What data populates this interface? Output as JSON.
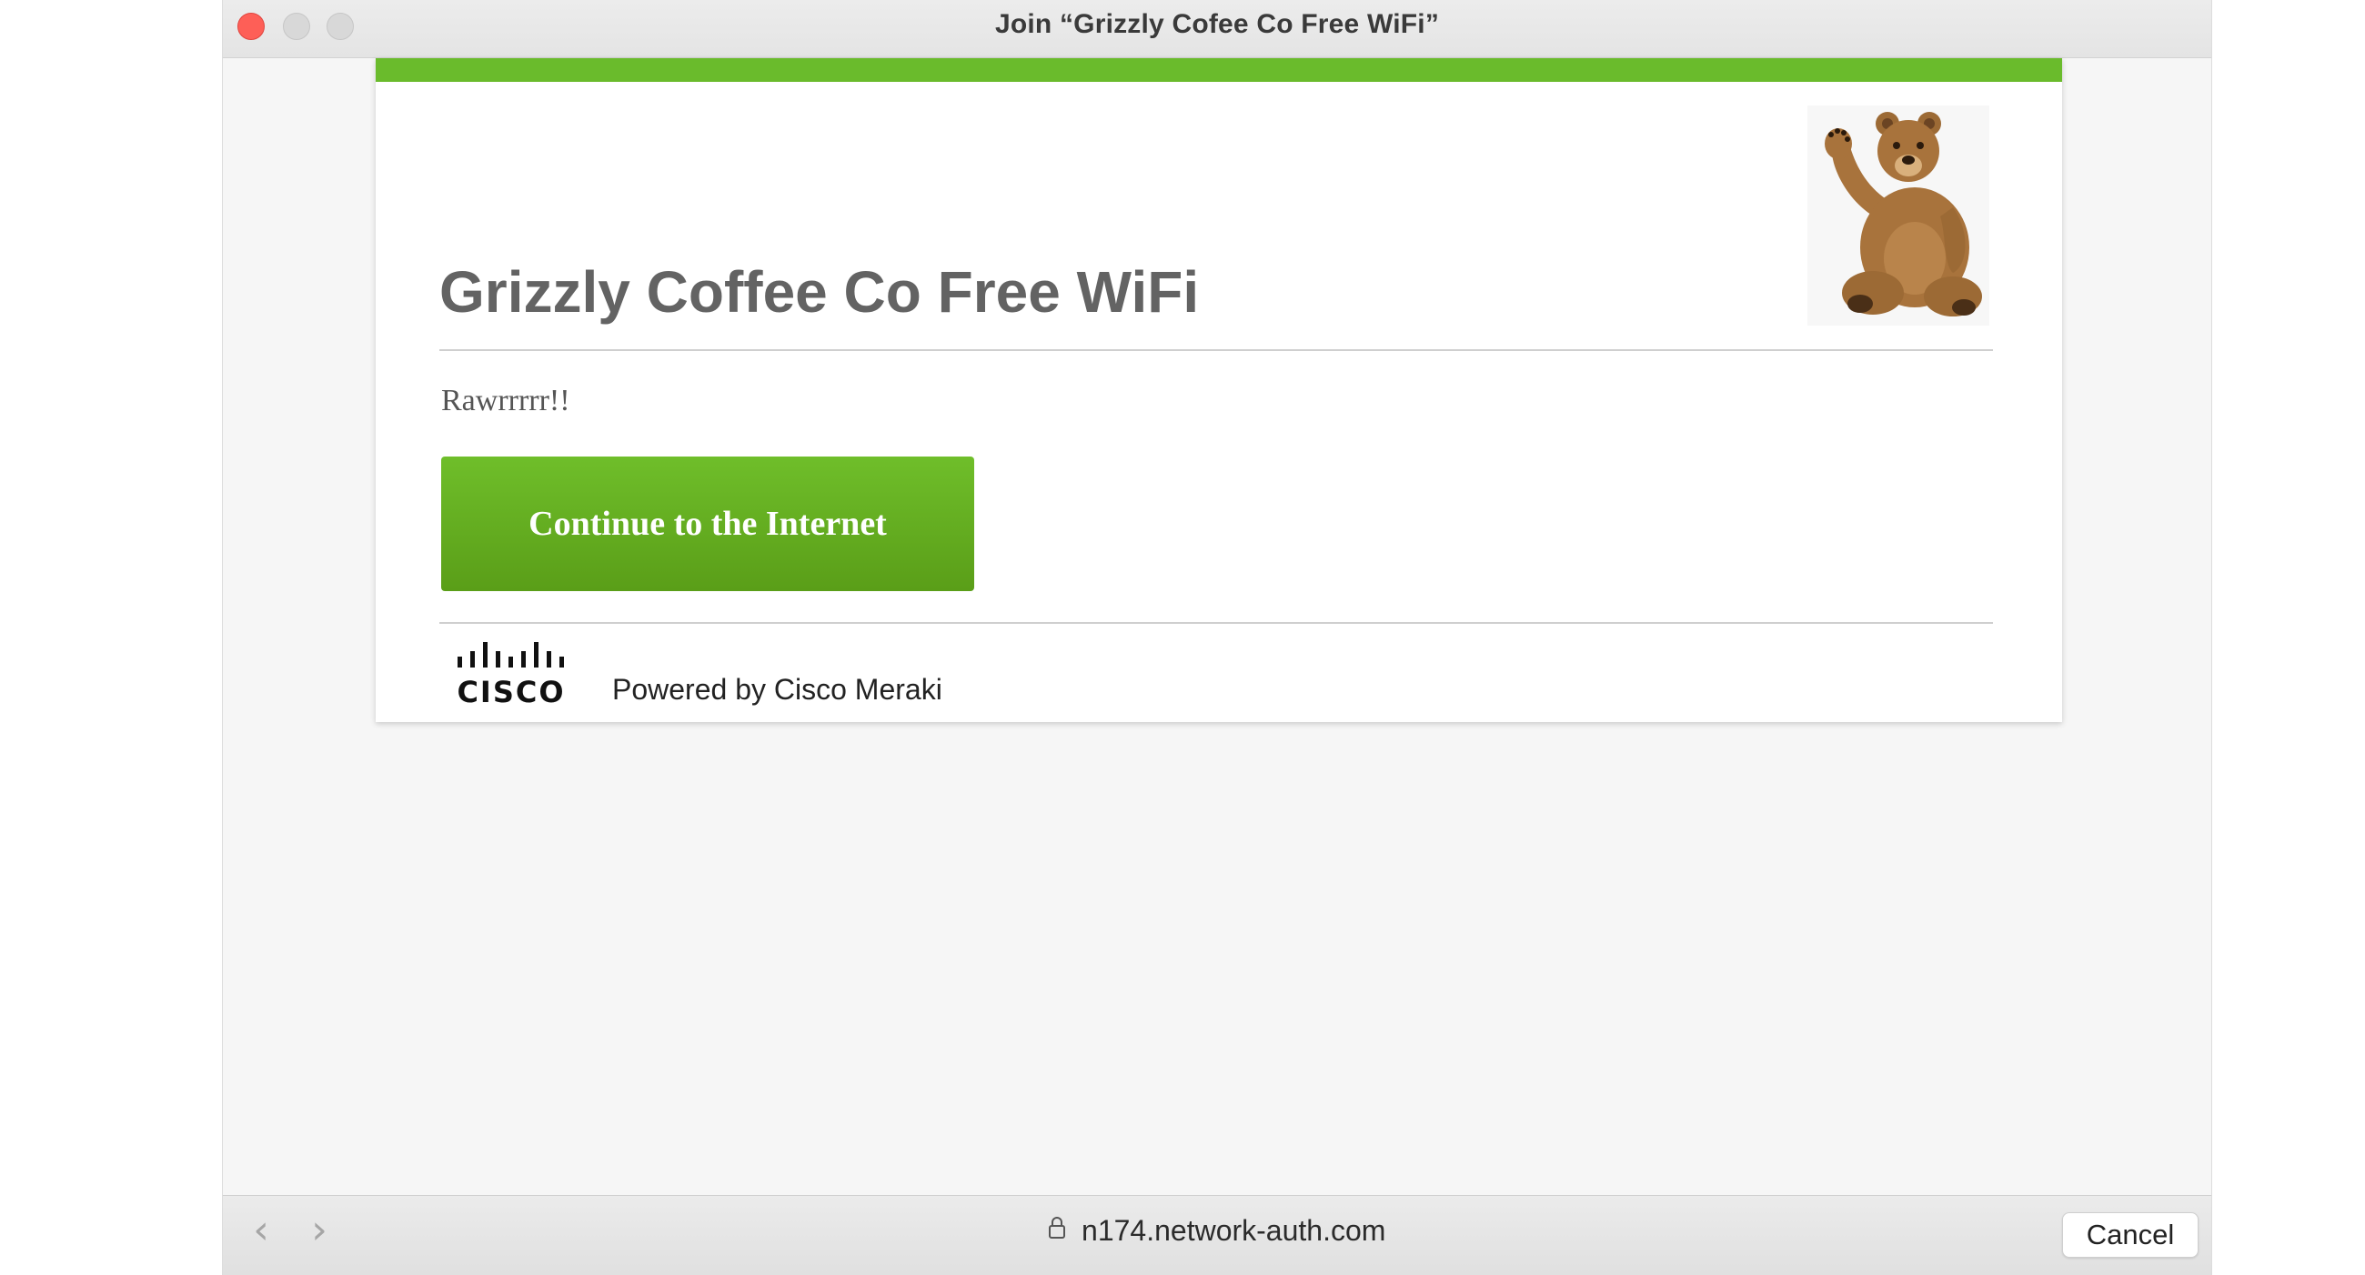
{
  "window": {
    "title": "Join “Grizzly Cofee Co Free WiFi”"
  },
  "portal": {
    "heading": "Grizzly Coffee Co Free WiFi",
    "tagline": "Rawrrrrr!!",
    "continue_label": "Continue to the Internet",
    "powered_by": "Powered by Cisco Meraki",
    "cisco_wordmark": "CISCO",
    "mascot_icon": "waving-bear-icon",
    "accent_color": "#6abb2c"
  },
  "bottom_bar": {
    "back_icon": "chevron-left-icon",
    "forward_icon": "chevron-right-icon",
    "lock_icon": "lock-icon",
    "url": "n174.network-auth.com",
    "cancel_label": "Cancel"
  }
}
